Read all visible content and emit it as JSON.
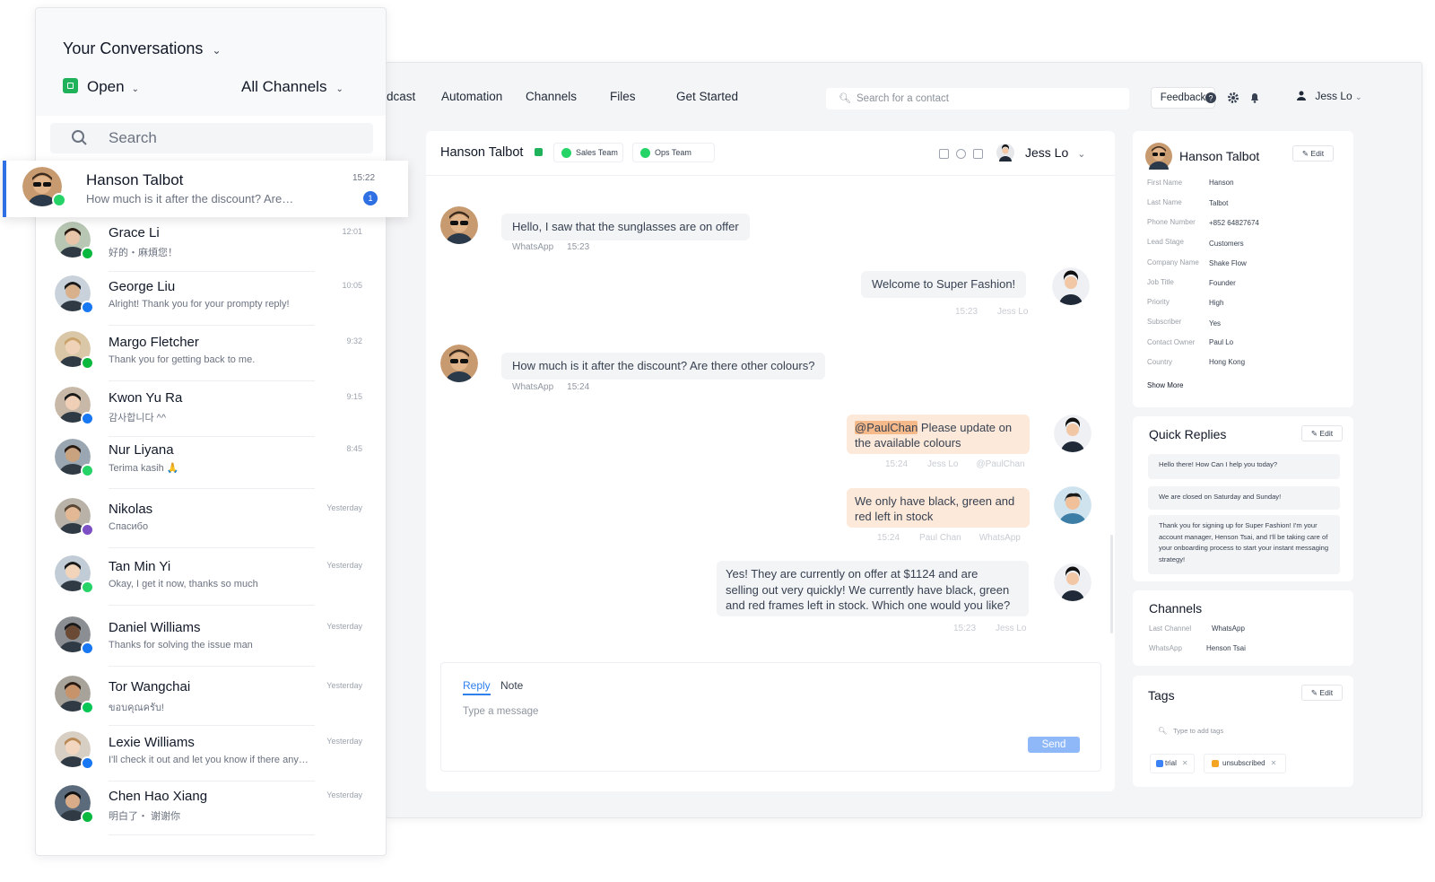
{
  "colors": {
    "accent_blue": "#2f6fe4",
    "whatsapp_green": "#25d366",
    "messenger_blue": "#1877f2",
    "viber_purple": "#7d4fc4",
    "wechat_green": "#09b83e",
    "send_button": "#8fb8f8",
    "mention_orange": "#fde9d9"
  },
  "conversations": {
    "title": "Your Conversations",
    "status_filter": "Open",
    "channel_filter": "All Channels",
    "search_placeholder": "Search",
    "active": {
      "name": "Hanson Talbot",
      "preview": "How much is it after the discount? Are…",
      "time": "15:22",
      "unread": "1",
      "channel_icon": "whatsapp-icon"
    },
    "items": [
      {
        "name": "Grace Li",
        "preview": "好的・麻煩您！",
        "time": "12:01",
        "channel_icon": "wechat-icon"
      },
      {
        "name": "George Liu",
        "preview": "Alright! Thank you for your prompty reply!",
        "time": "10:05",
        "channel_icon": "messenger-icon"
      },
      {
        "name": "Margo Fletcher",
        "preview": "Thank you for getting back to me.",
        "time": "9:32",
        "channel_icon": "wechat-icon"
      },
      {
        "name": "Kwon Yu Ra",
        "preview": "감사합니다 ^^",
        "time": "9:15",
        "channel_icon": "messenger-icon"
      },
      {
        "name": "Nur Liyana",
        "preview": "Terima kasih 🙏",
        "time": "8:45",
        "channel_icon": "whatsapp-icon"
      },
      {
        "name": "Nikolas",
        "preview": "Спасибо",
        "time": "Yesterday",
        "channel_icon": "viber-icon"
      },
      {
        "name": "Tan Min Yi",
        "preview": "Okay, I get it now, thanks so much",
        "time": "Yesterday",
        "channel_icon": "whatsapp-icon"
      },
      {
        "name": "Daniel Williams",
        "preview": "Thanks for solving the issue man",
        "time": "Yesterday",
        "channel_icon": "messenger-icon"
      },
      {
        "name": "Tor Wangchai",
        "preview": "ขอบคุณครับ!",
        "time": "Yesterday",
        "channel_icon": "line-icon"
      },
      {
        "name": "Lexie Williams",
        "preview": "I'll check it out and let you know if there any…",
        "time": "Yesterday",
        "channel_icon": "messenger-icon"
      },
      {
        "name": "Chen Hao Xiang",
        "preview": "明白了・ 谢谢你",
        "time": "Yesterday",
        "channel_icon": "wechat-icon"
      }
    ]
  },
  "topnav": {
    "items": [
      "dcast",
      "Automation",
      "Channels",
      "Files",
      "Get Started"
    ],
    "search_placeholder": "Search for a contact",
    "feedback": "Feedback",
    "user": "Jess Lo"
  },
  "chat": {
    "contact_name": "Hanson Talbot",
    "teams": [
      "Sales Team",
      "Ops Team"
    ],
    "assignee": "Jess Lo",
    "messages": [
      {
        "text": "Hello, I saw that the sunglasses are on offer",
        "channel": "WhatsApp",
        "time": "15:23"
      },
      {
        "text": "Welcome to Super Fashion!",
        "time": "15:23",
        "author": "Jess Lo"
      },
      {
        "text": "How much is it after the discount? Are there other colours?",
        "channel": "WhatsApp",
        "time": "15:24"
      },
      {
        "mention": "@PaulChan",
        "text_line1": " Please update on",
        "text_line2": "the available colours",
        "time": "15:24",
        "author": "Jess Lo",
        "mentioned": "@PaulChan"
      },
      {
        "text_line1": "We only have black, green and",
        "text_line2": "red left in stock",
        "time": "15:24",
        "author": "Paul Chan",
        "channel": "WhatsApp"
      },
      {
        "text_line1": "Yes! They are currently on offer at $1124 and are",
        "text_line2": "selling out very quickly! We currently have black, green",
        "text_line3": "and red frames left in stock. Which one would you like?",
        "time": "15:23",
        "author": "Jess Lo"
      }
    ],
    "composer": {
      "tab_reply": "Reply",
      "tab_note": "Note",
      "placeholder": "Type a message",
      "send": "Send"
    }
  },
  "contact_card": {
    "name": "Hanson Talbot",
    "edit": "Edit",
    "fields": [
      {
        "label": "First Name",
        "value": "Hanson"
      },
      {
        "label": "Last Name",
        "value": "Talbot"
      },
      {
        "label": "Phone Number",
        "value": "+852 64827674"
      },
      {
        "label": "Lead Stage",
        "value": "Customers"
      },
      {
        "label": "Company Name",
        "value": "Shake Flow"
      },
      {
        "label": "Job Title",
        "value": "Founder"
      },
      {
        "label": "Priority",
        "value": "High"
      },
      {
        "label": "Subscriber",
        "value": "Yes"
      },
      {
        "label": "Contact Owner",
        "value": "Paul Lo"
      },
      {
        "label": "Country",
        "value": "Hong Kong"
      }
    ],
    "show_more": "Show More"
  },
  "quick_replies": {
    "title": "Quick Replies",
    "edit": "Edit",
    "items": [
      "Hello there! How Can I help you today?",
      "We are closed on Saturday and Sunday!",
      "Thank you for signing up for Super Fashion! I'm your account manager, Henson Tsai, and I'll be taking care of your onboarding process to start your instant messaging strategy!"
    ]
  },
  "channels_card": {
    "title": "Channels",
    "rows": [
      {
        "label": "Last Channel",
        "value": "WhatsApp"
      },
      {
        "label": "WhatsApp",
        "value": "Henson Tsai"
      }
    ]
  },
  "tags_card": {
    "title": "Tags",
    "edit": "Edit",
    "placeholder": "Type to add tags",
    "tags": [
      {
        "label": "trial",
        "color": "#3b82f6"
      },
      {
        "label": "unsubscribed",
        "color": "#f5a524"
      }
    ]
  }
}
